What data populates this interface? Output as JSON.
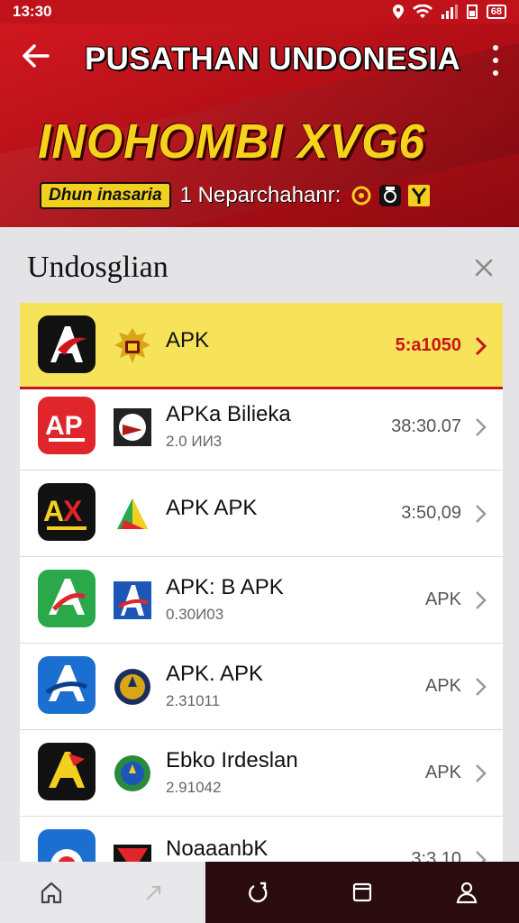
{
  "status": {
    "time": "13:30",
    "battery": "68"
  },
  "header": {
    "title": "PUSATHAN UNDONESIA",
    "headline": "INOHOMBI XVG6",
    "tag_pill": "Dhun inasaria",
    "tag_text": "1 Neparchahanr:"
  },
  "section": {
    "title": "Undosglian"
  },
  "list": {
    "items": [
      {
        "title": "APK",
        "subtitle": "",
        "value": "5:a1050",
        "icon": "apk-red-arrow-icon",
        "active": true
      },
      {
        "title": "APKa Bilieka",
        "subtitle": "2.0 ИИ3",
        "value": "38:30.07",
        "icon": "ap-logo-icon",
        "active": false
      },
      {
        "title": "APK APK",
        "subtitle": "",
        "value": "3:50,09",
        "icon": "ax-logo-icon",
        "active": false
      },
      {
        "title": "APK: B APK",
        "subtitle": "0.30И03",
        "value": "APK",
        "icon": "a-green-logo-icon",
        "active": false
      },
      {
        "title": "APK. APK",
        "subtitle": "2.31011",
        "value": "APK",
        "icon": "a-blue-logo-icon",
        "active": false
      },
      {
        "title": "Ebko Irdeslan",
        "subtitle": "2.91042",
        "value": "APK",
        "icon": "a-yellow-logo-icon",
        "active": false
      },
      {
        "title": "NoaaanbK",
        "subtitle": "",
        "value": "3:3.10",
        "icon": "target-logo-icon",
        "active": false
      }
    ]
  },
  "colors": {
    "brand_red": "#c0121a",
    "accent_yellow": "#f3cf1f",
    "active_row": "#f6e359"
  }
}
